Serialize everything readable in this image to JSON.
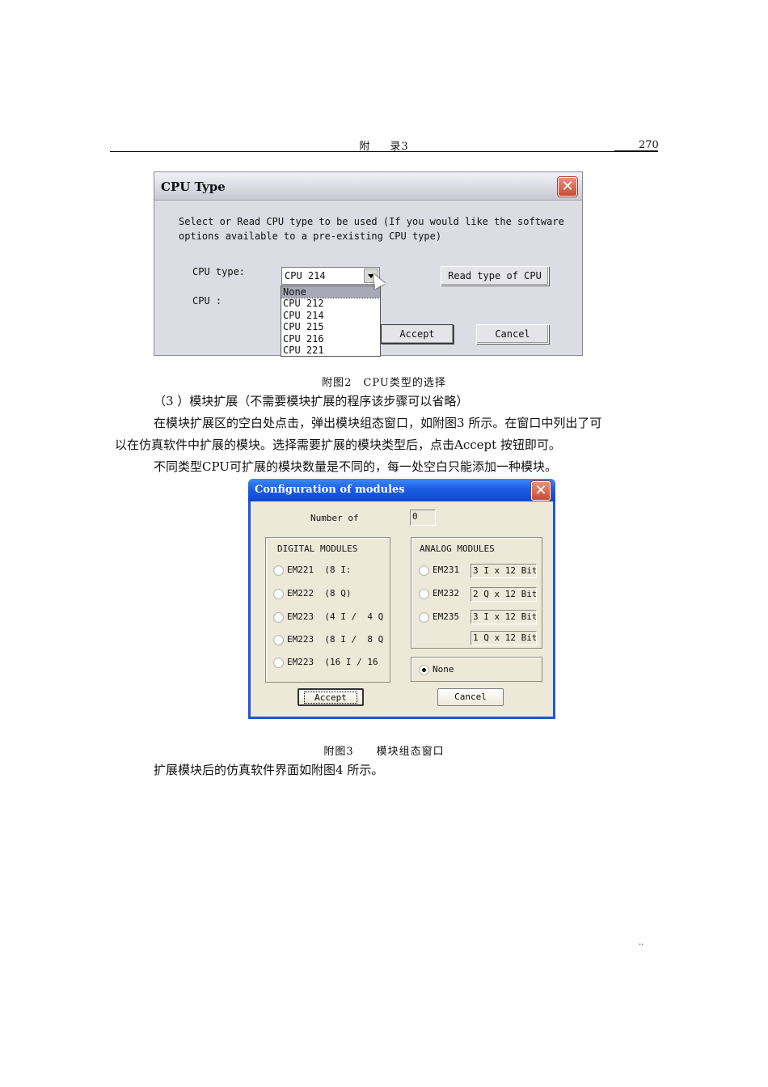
{
  "header": {
    "section_left": "附",
    "section_right": "录3",
    "page_number": "270"
  },
  "cpu_dialog": {
    "title": "CPU Type",
    "description_line1": "Select or Read CPU type to be used (If you would like the software",
    "description_line2": "options available to a pre-existing CPU type)",
    "cpu_type_label": "CPU type:",
    "cpu_label": "CPU :",
    "cpu_type_value": "CPU 214",
    "dropdown_options": [
      "None",
      "CPU 212",
      "CPU 214",
      "CPU 215",
      "CPU 216",
      "CPU 221"
    ],
    "highlighted_option": "None",
    "read_button": "Read type of CPU",
    "accept_button": "Accept",
    "cancel_button": "Cancel"
  },
  "caption2": "附图2　CPU类型的选择",
  "paragraphs": [
    "（3 ）模块扩展（不需要模块扩展的程序该步骤可以省略）",
    "在模块扩展区的空白处点击，弹出模块组态窗口，如附图3 所示。在窗口中列出了可",
    "以在仿真软件中扩展的模块。选择需要扩展的模块类型后，点击Accept 按钮即可。",
    "不同类型CPU可扩展的模块数量是不同的，每一处空白只能添加一种模块。"
  ],
  "config_dialog": {
    "title": "Configuration of modules",
    "number_label": "Number of",
    "number_value": "0",
    "digital_title": "DIGITAL MODULES",
    "digital_modules": [
      "EM221  (8 I:",
      "EM222  (8 Q)",
      "EM223  (4 I /  4 Q",
      "EM223  (8 I /  8 Q",
      "EM223  (16 I / 16"
    ],
    "analog_title": "ANALOG MODULES",
    "analog_modules": [
      {
        "label": "EM231",
        "field": "3 I x 12 Bit"
      },
      {
        "label": "EM232",
        "field": "2 Q x 12 Bit"
      },
      {
        "label": "EM235",
        "field": "3 I x 12 Bit"
      }
    ],
    "analog_extra_field": "1 Q x 12 Bit",
    "none_label": "None",
    "selected": "None",
    "accept_button": "Accept",
    "cancel_button": "Cancel"
  },
  "caption3": "附图3　　模块组态窗口",
  "paragraph_final": "扩展模块后的仿真软件界面如附图4 所示。",
  "footer_marks": ".."
}
